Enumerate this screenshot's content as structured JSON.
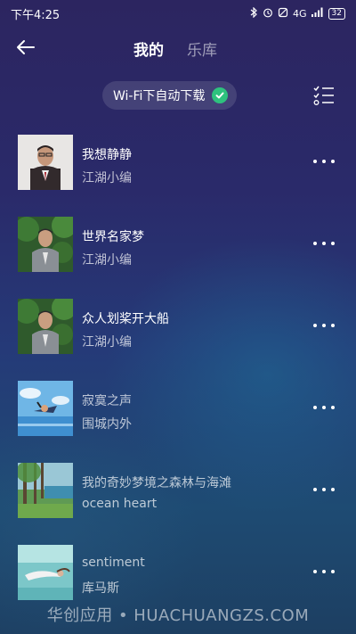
{
  "status_bar": {
    "time": "下午4:25",
    "network": "4G",
    "battery": "32"
  },
  "header": {
    "tabs": [
      {
        "label": "我的",
        "active": true
      },
      {
        "label": "乐库",
        "active": false
      }
    ]
  },
  "wifi_download": {
    "label": "Wi-Fi下自动下载",
    "enabled": true
  },
  "songs": [
    {
      "title": "我想静静",
      "artist": "江湖小编",
      "cover": "portrait-suit-man"
    },
    {
      "title": "世界名家梦",
      "artist": "江湖小编",
      "cover": "portrait-man-trees"
    },
    {
      "title": "众人划桨开大船",
      "artist": "江湖小编",
      "cover": "portrait-man-trees"
    },
    {
      "title": "寂寞之声",
      "artist": "围城内外",
      "cover": "anime-sky-flying"
    },
    {
      "title": "我的奇妙梦境之森林与海滩",
      "artist": "ocean heart",
      "cover": "forest-beach"
    },
    {
      "title": "sentiment",
      "artist": "库马斯",
      "cover": "underwater-girl"
    }
  ],
  "watermark": "华创应用 • HUACHUANGZS.COM",
  "colors": {
    "accent_green": "#2ec27e",
    "background_top": "#2c2560",
    "background_bottom": "#1d3f62"
  }
}
